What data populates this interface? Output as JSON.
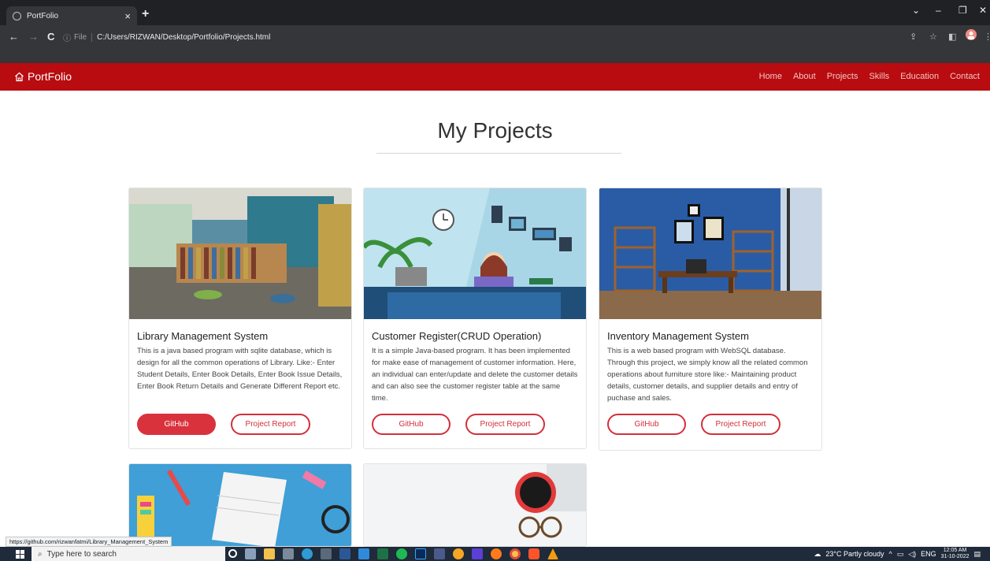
{
  "browser": {
    "tab_title": "PortFolio",
    "tab_close": "×",
    "new_tab": "+",
    "info_glyph": "ⓘ",
    "scheme": "File",
    "url": "C:/Users/RIZWAN/Desktop/Portfolio/Projects.html",
    "back": "←",
    "forward": "→",
    "reload": "C",
    "minimize": "–",
    "maximize": "❐",
    "close": "✕",
    "chevron": "⌄"
  },
  "site": {
    "brand": "PortFolio",
    "menu": [
      "Home",
      "About",
      "Projects",
      "Skills",
      "Education",
      "Contact"
    ],
    "heading": "My Projects"
  },
  "projects": [
    {
      "title": "Library Management System",
      "description": "This is a java based program with sqlite database, which is design for all the common operations of Library. Like:- Enter Student Details, Enter Book Details, Enter Book Issue Details, Enter Book Return Details and Generate Different Report etc.",
      "github_label": "GitHub",
      "report_label": "Project Report"
    },
    {
      "title": "Customer Register(CRUD Operation)",
      "description": "It is a simple Java-based program. It has been implemented for make ease of management of customer information. Here, an individual can enter/update and delete the customer details and can also see the customer register table at the same time.",
      "github_label": "GitHub",
      "report_label": "Project Report"
    },
    {
      "title": "Inventory Management System",
      "description": "This is a web based program with WebSQL database. Through this project, we simply know all the related common operations about furniture store like:- Maintaining product details, customer details, and supplier details and entry of puchase and sales.",
      "github_label": "GitHub",
      "report_label": "Project Report"
    }
  ],
  "status_url": "https://github.com/rizwanfatmi/Library_Management_System",
  "taskbar": {
    "search_placeholder": "Type here to search",
    "weather": "23°C  Partly cloudy",
    "lang": "ENG",
    "time": "12:05 AM",
    "date": "31-10-2022"
  },
  "colors": {
    "header_red": "#b80c10",
    "button_red": "#d9323d"
  }
}
